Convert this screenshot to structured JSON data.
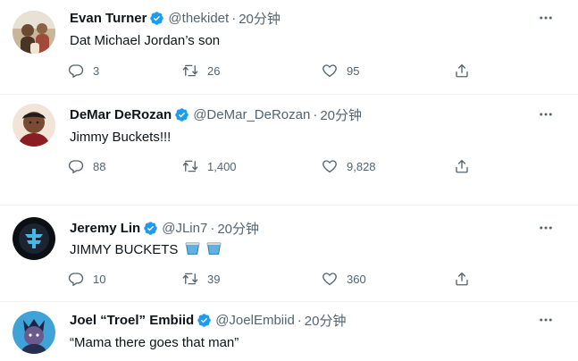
{
  "tweets": [
    {
      "name": "Evan Turner",
      "handle": "@thekidet",
      "time": "20分钟",
      "text": "Dat Michael Jordan’s son",
      "replies": "3",
      "retweets": "26",
      "likes": "95"
    },
    {
      "name": "DeMar DeRozan",
      "handle": "@DeMar_DeRozan",
      "time": "20分钟",
      "text": "Jimmy Buckets!!!",
      "replies": "88",
      "retweets": "1,400",
      "likes": "9,828"
    },
    {
      "name": "Jeremy Lin",
      "handle": "@JLin7",
      "time": "20分钟",
      "text": "JIMMY BUCKETS",
      "replies": "10",
      "retweets": "39",
      "likes": "360"
    },
    {
      "name": "Joel “Troel” Embiid",
      "handle": "@JoelEmbiid",
      "time": "20分钟",
      "text": "“Mama there goes that man”"
    }
  ],
  "separator": "·",
  "colors": {
    "verified": "#1d9bf0",
    "secondary_text": "#536471",
    "primary_text": "#0f1419",
    "divider": "#eff3f4"
  },
  "icons": [
    "verified-badge-icon",
    "more-icon",
    "reply-icon",
    "retweet-icon",
    "like-icon",
    "share-icon",
    "bucket-emoji-icon"
  ]
}
